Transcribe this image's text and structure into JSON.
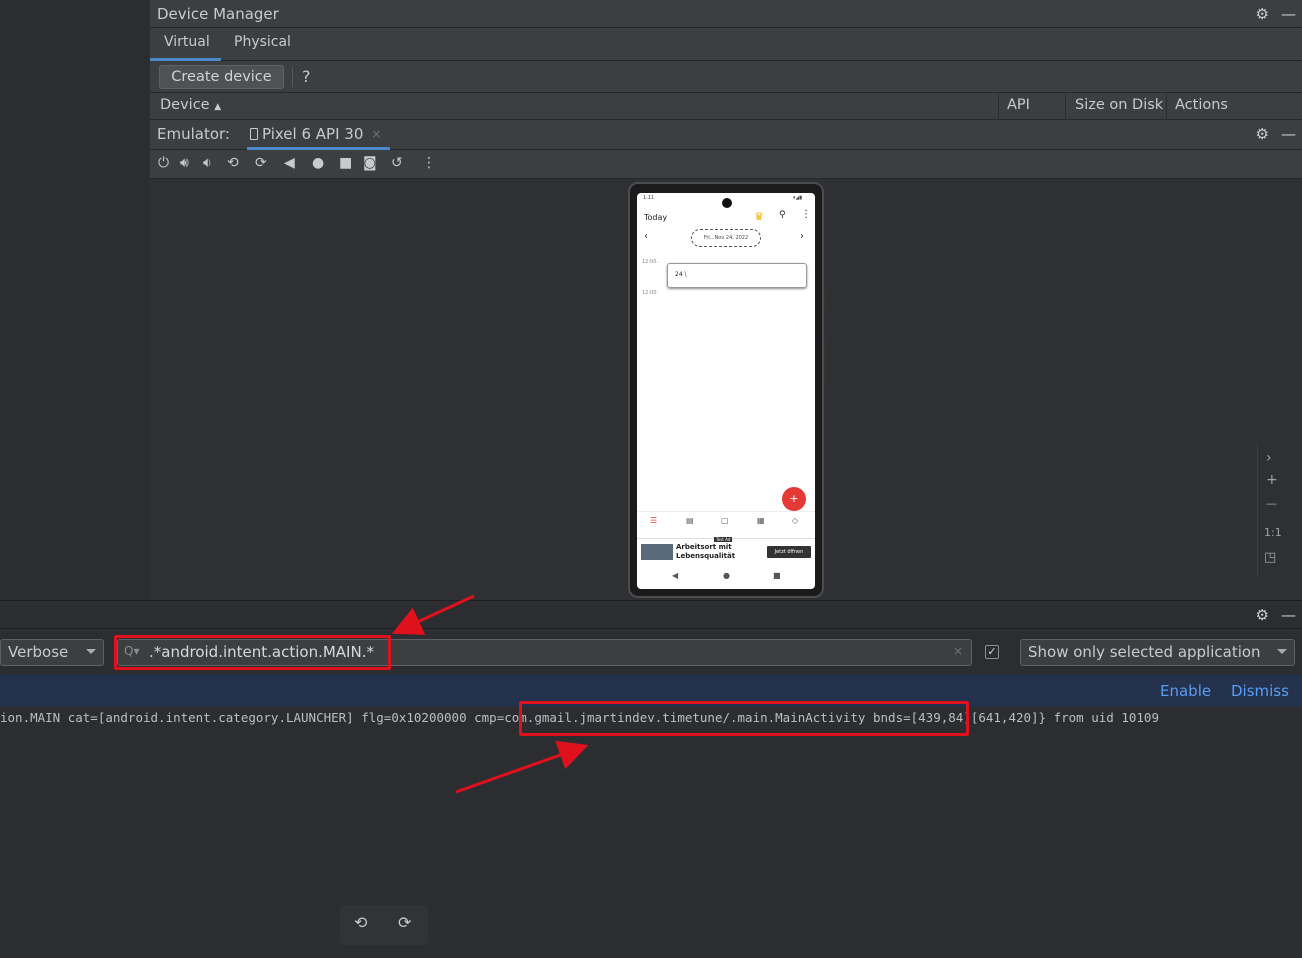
{
  "device_manager": {
    "title": "Device Manager",
    "tabs": [
      {
        "label": "Virtual"
      },
      {
        "label": "Physical"
      }
    ],
    "create_device": "Create device",
    "help": "?",
    "columns": {
      "device": "Device",
      "sort": "▲",
      "api": "API",
      "size": "Size on Disk",
      "actions": "Actions"
    }
  },
  "emulator": {
    "label": "Emulator:",
    "tab_label": "Pixel 6 API 30",
    "close": "×"
  },
  "phone": {
    "status_time": "1:11",
    "header_title": "Today",
    "date_text": "Fri., Nov 24, 2022",
    "time_slot_1": "12:00..",
    "time_slot_2": "12:00:",
    "entry_text": "24 \\",
    "fab": "+",
    "ad_title_1": "Arbeitsort mit",
    "ad_title_2": "Lebensqualität",
    "ad_badge": "Test Ad",
    "ad_button": "Jetzt öffnen"
  },
  "zoom": {
    "plus": "+",
    "minus": "—",
    "one_to_one": "1:1"
  },
  "logcat": {
    "level": "Verbose",
    "filter": ".*android.intent.action.MAIN.*",
    "clear": "×",
    "checkbox": "✓",
    "app_filter": "Show only selected application",
    "enable": "Enable",
    "dismiss": "Dismiss",
    "log_prefix": "ion.MAIN cat=[android.intent.category.LAUNCHER] flg=0x10200000 ",
    "log_cmp": "cmp=com.gmail.jmartindev.timetune/.main.MainActivity",
    "log_suffix": " bnds=[439,84][641,420]} from uid 10109"
  },
  "colors": {
    "accent": "#4a88c7",
    "highlight": "#e0101c",
    "fab": "#e53935",
    "link": "#589df6"
  }
}
